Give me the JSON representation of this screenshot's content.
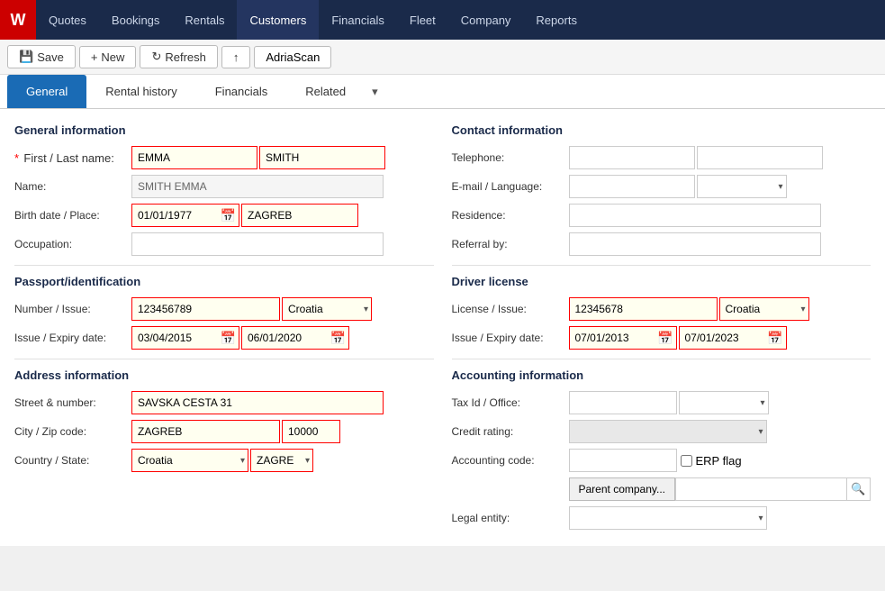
{
  "logo": {
    "text": "W"
  },
  "nav": {
    "items": [
      {
        "label": "Quotes",
        "id": "quotes",
        "active": false
      },
      {
        "label": "Bookings",
        "id": "bookings",
        "active": false
      },
      {
        "label": "Rentals",
        "id": "rentals",
        "active": false
      },
      {
        "label": "Customers",
        "id": "customers",
        "active": true
      },
      {
        "label": "Financials",
        "id": "financials",
        "active": false
      },
      {
        "label": "Fleet",
        "id": "fleet",
        "active": false
      },
      {
        "label": "Company",
        "id": "company",
        "active": false
      },
      {
        "label": "Reports",
        "id": "reports",
        "active": false
      }
    ]
  },
  "toolbar": {
    "save_label": "Save",
    "new_label": "New",
    "refresh_label": "Refresh",
    "export_label": "↑",
    "adriascan_label": "AdriaScan"
  },
  "tabs": {
    "items": [
      {
        "label": "General",
        "active": true
      },
      {
        "label": "Rental history",
        "active": false
      },
      {
        "label": "Financials",
        "active": false
      },
      {
        "label": "Related",
        "active": false
      }
    ],
    "more_label": "▾"
  },
  "general_info": {
    "title": "General information",
    "first_name": "EMMA",
    "last_name": "SMITH",
    "name": "SMITH EMMA",
    "birth_date": "01/01/1977",
    "birth_place": "ZAGREB",
    "occupation": "",
    "labels": {
      "first_last_name": "First / Last name:",
      "name": "Name:",
      "birth_date_place": "Birth date / Place:",
      "occupation": "Occupation:"
    }
  },
  "passport": {
    "title": "Passport/identification",
    "number": "123456789",
    "country": "Croatia",
    "issue_date": "03/04/2015",
    "expiry_date": "06/01/2020",
    "labels": {
      "number_issue": "Number / Issue:",
      "issue_expiry": "Issue / Expiry date:"
    }
  },
  "address": {
    "title": "Address information",
    "street": "SAVSKA CESTA 31",
    "city": "ZAGREB",
    "zip": "10000",
    "country": "Croatia",
    "state": "ZAGRE",
    "labels": {
      "street": "Street & number:",
      "city_zip": "City / Zip code:",
      "country_state": "Country / State:"
    }
  },
  "contact": {
    "title": "Contact information",
    "telephone1": "",
    "telephone2": "",
    "email": "",
    "language": "",
    "residence": "",
    "referral": "",
    "labels": {
      "telephone": "Telephone:",
      "email_language": "E-mail / Language:",
      "residence": "Residence:",
      "referral": "Referral by:"
    }
  },
  "driver_license": {
    "title": "Driver license",
    "license_number": "12345678",
    "country": "Croatia",
    "issue_date": "07/01/2013",
    "expiry_date": "07/01/2023",
    "labels": {
      "license_issue": "License / Issue:",
      "issue_expiry": "Issue / Expiry date:"
    }
  },
  "accounting": {
    "title": "Accounting information",
    "tax_id": "",
    "tax_office": "",
    "credit_rating": "",
    "accounting_code": "",
    "erp_flag": false,
    "parent_company": "",
    "legal_entity": "",
    "labels": {
      "tax_id_office": "Tax Id / Office:",
      "credit_rating": "Credit rating:",
      "accounting_code": "Accounting code:",
      "erp_flag": "ERP flag",
      "parent_company": "Parent company...",
      "legal_entity": "Legal entity:"
    }
  }
}
